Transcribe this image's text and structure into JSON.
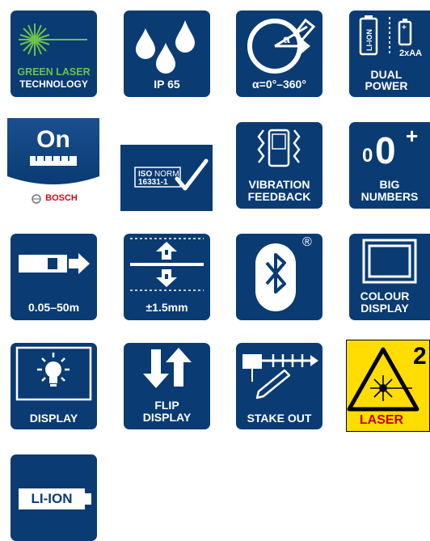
{
  "icons": {
    "green_laser": {
      "line1": "GREEN LASER",
      "line2": "TECHNOLOGY",
      "accent": "#6cc24a"
    },
    "ip65": {
      "label": "IP 65"
    },
    "angle": {
      "label": "α=0°–360°",
      "symbol": "α"
    },
    "dual_power": {
      "label1": "DUAL",
      "label2": "POWER",
      "battery_text": "LI-ION",
      "aa_text": "2xAA"
    },
    "bosch_on": {
      "big": "On",
      "brand": "BOSCH",
      "brand_color": "#e2001a"
    },
    "iso": {
      "line1_bold": "ISO",
      "line1_rest": " NORM",
      "line2": "16331-1"
    },
    "vibration": {
      "line1": "VIBRATION",
      "line2": "FEEDBACK"
    },
    "big_numbers": {
      "small": "0",
      "big": "0",
      "plus": "+",
      "line1": "BIG",
      "line2": "NUMBERS"
    },
    "range": {
      "label": "0.05–50m"
    },
    "accuracy": {
      "label": "±1.5mm"
    },
    "bluetooth": {
      "reg": "®"
    },
    "colour_display": {
      "line1": "COLOUR",
      "line2": "DISPLAY"
    },
    "display": {
      "label": "DISPLAY"
    },
    "flip_display": {
      "line1": "FLIP",
      "line2": "DISPLAY"
    },
    "stake_out": {
      "label": "STAKE OUT"
    },
    "laser_class": {
      "label": "LASER",
      "class": "2",
      "warn_color": "#ffdd00"
    },
    "li_ion": {
      "label": "LI-ION"
    }
  }
}
